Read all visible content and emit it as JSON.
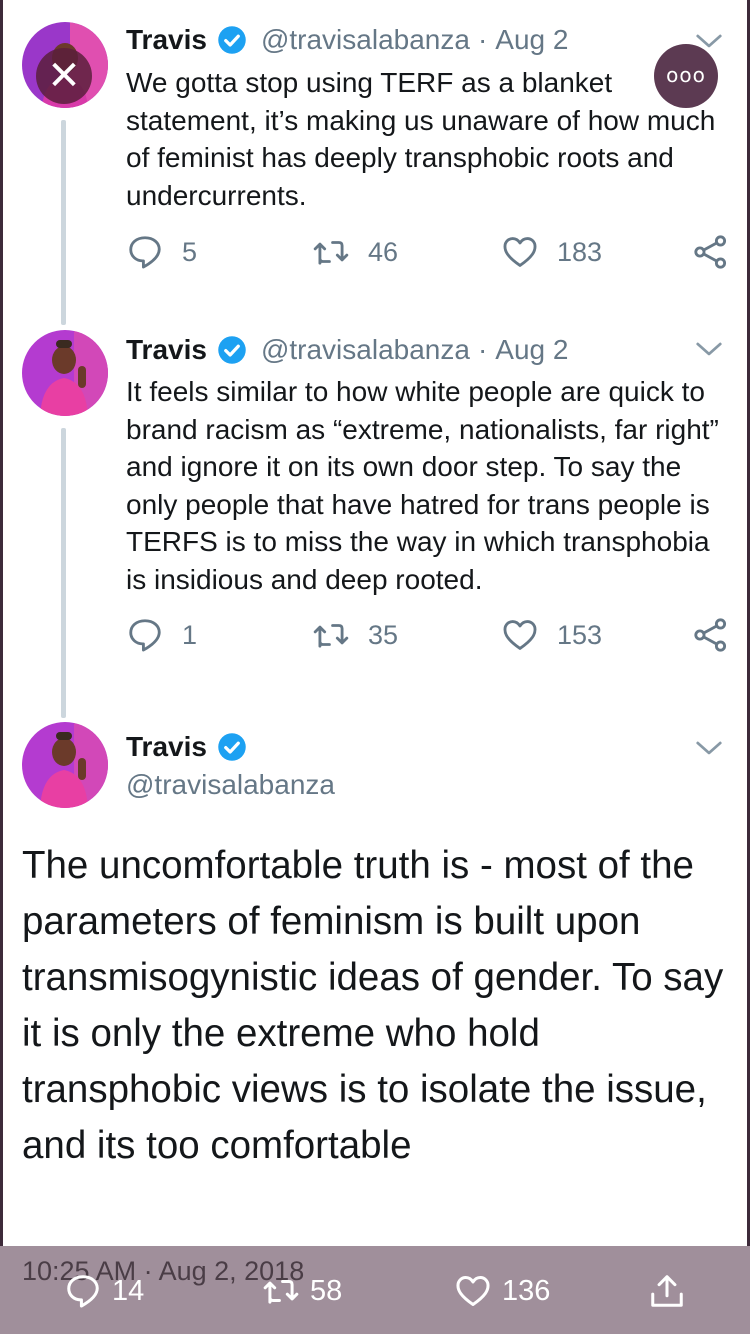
{
  "tweets": [
    {
      "name": "Travis",
      "handle": "@travisalabanza",
      "date": "Aug 2",
      "text": "We gotta stop using TERF as a blanket statement, it’s making us unaware of how much of feminist has deeply transphobic roots and undercurrents.",
      "replies": "5",
      "retweets": "46",
      "likes": "183"
    },
    {
      "name": "Travis",
      "handle": "@travisalabanza",
      "date": "Aug 2",
      "text": "It feels similar to how white people are quick to brand racism as “extreme, nationalists, far right” and ignore it on its own door step. To say the only people that have hatred for trans people is TERFS is to miss the way in which transphobia is insidious and deep rooted.",
      "replies": "1",
      "retweets": "35",
      "likes": "153"
    }
  ],
  "main_tweet": {
    "name": "Travis",
    "handle": "@travisalabanza",
    "text": "The uncomfortable truth is - most of the parameters of feminism is built upon transmisogynistic ideas of gender. To say it is only the extreme who hold transphobic views is to isolate the issue, and its too comfortable",
    "timestamp": "10:25 AM · Aug 2, 2018",
    "replies": "14",
    "retweets": "58",
    "likes": "136"
  },
  "separator": "·",
  "overlay": {
    "close_symbol": "✕",
    "more_symbol": "ooo"
  },
  "colors": {
    "verified": "#1da1f2",
    "muted": "#657786",
    "bottom_bar": "#a08f9b",
    "avatar_bg": "#c23fd1"
  },
  "icons": [
    "reply-icon",
    "retweet-icon",
    "like-icon",
    "share-icon",
    "chevron-down-icon",
    "verified-icon",
    "close-icon",
    "more-icon",
    "upload-icon"
  ]
}
